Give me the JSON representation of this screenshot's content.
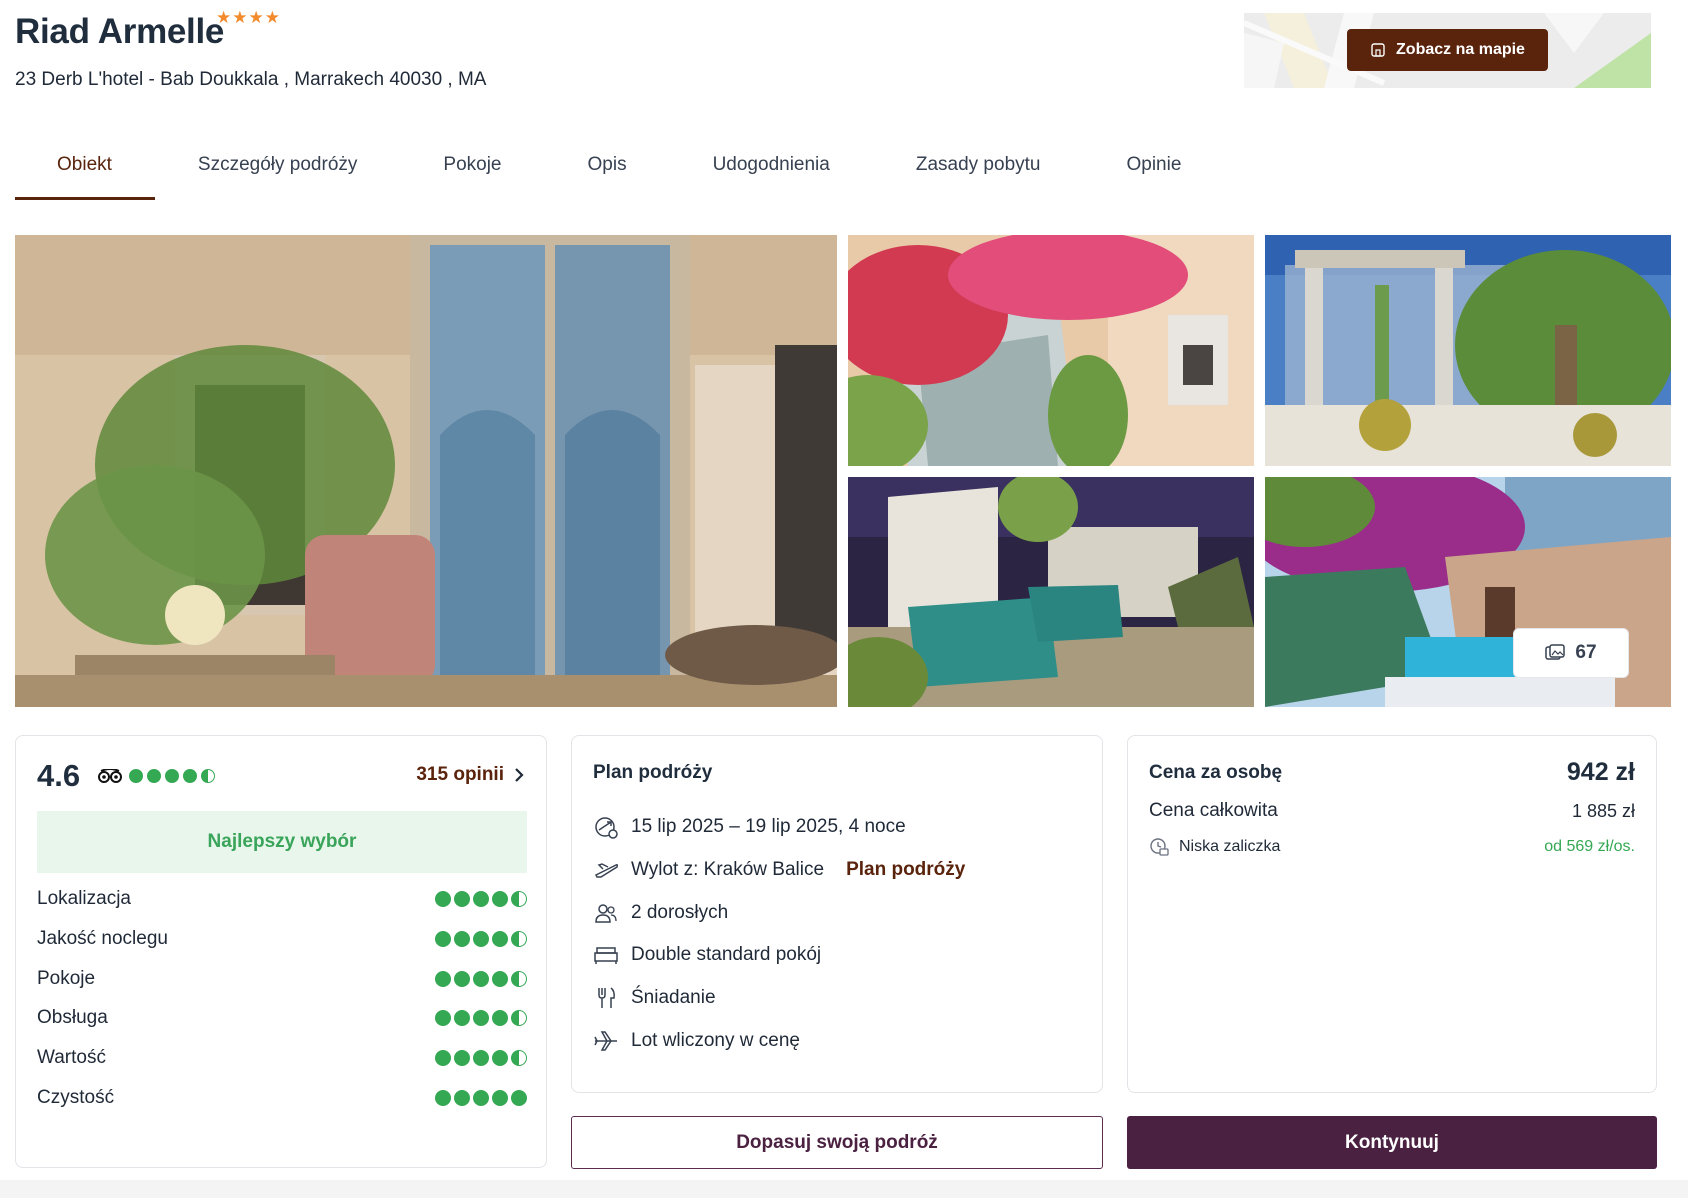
{
  "hotel": {
    "name": "Riad Armelle",
    "stars_display": "★★★★",
    "address": "23 Derb L'hotel - Bab Doukkala , Marrakech 40030 , MA"
  },
  "map": {
    "button_label": "Zobacz na mapie"
  },
  "tabs": [
    {
      "label": "Obiekt"
    },
    {
      "label": "Szczegóły podróży"
    },
    {
      "label": "Pokoje"
    },
    {
      "label": "Opis"
    },
    {
      "label": "Udogodnienia"
    },
    {
      "label": "Zasady pobytu"
    },
    {
      "label": "Opinie"
    }
  ],
  "gallery": {
    "photo_count": "67"
  },
  "rating": {
    "score": "4.6",
    "tripadvisor_dots": 4.5,
    "reviews_link": "315 opinii",
    "badge": "Najlepszy wybór",
    "categories": [
      {
        "label": "Lokalizacja",
        "dots": 4.5
      },
      {
        "label": "Jakość noclegu",
        "dots": 4.5
      },
      {
        "label": "Pokoje",
        "dots": 4.5
      },
      {
        "label": "Obsługa",
        "dots": 4.5
      },
      {
        "label": "Wartość",
        "dots": 4.5
      },
      {
        "label": "Czystość",
        "dots": 5
      }
    ]
  },
  "plan": {
    "title": "Plan podróży",
    "dates": "15 lip 2025 – 19 lip 2025, 4 noce",
    "departure": "Wylot z: Kraków Balice",
    "departure_link": "Plan podróży",
    "guests": "2 dorosłych",
    "room": "Double standard pokój",
    "board": "Śniadanie",
    "flight": "Lot wliczony w cenę"
  },
  "price": {
    "per_person_label": "Cena za osobę",
    "per_person_value": "942 zł",
    "total_label": "Cena całkowita",
    "total_value": "1 885 zł",
    "deposit_label": "Niska zaliczka",
    "deposit_value": "od 569 zł/os."
  },
  "actions": {
    "customize_label": "Dopasuj swoją podróż",
    "continue_label": "Kontynuuj"
  },
  "colors": {
    "brand_brown": "#5a230c",
    "brand_plum": "#4a2140",
    "rating_green": "#34a853",
    "star_orange": "#f28b2c"
  }
}
